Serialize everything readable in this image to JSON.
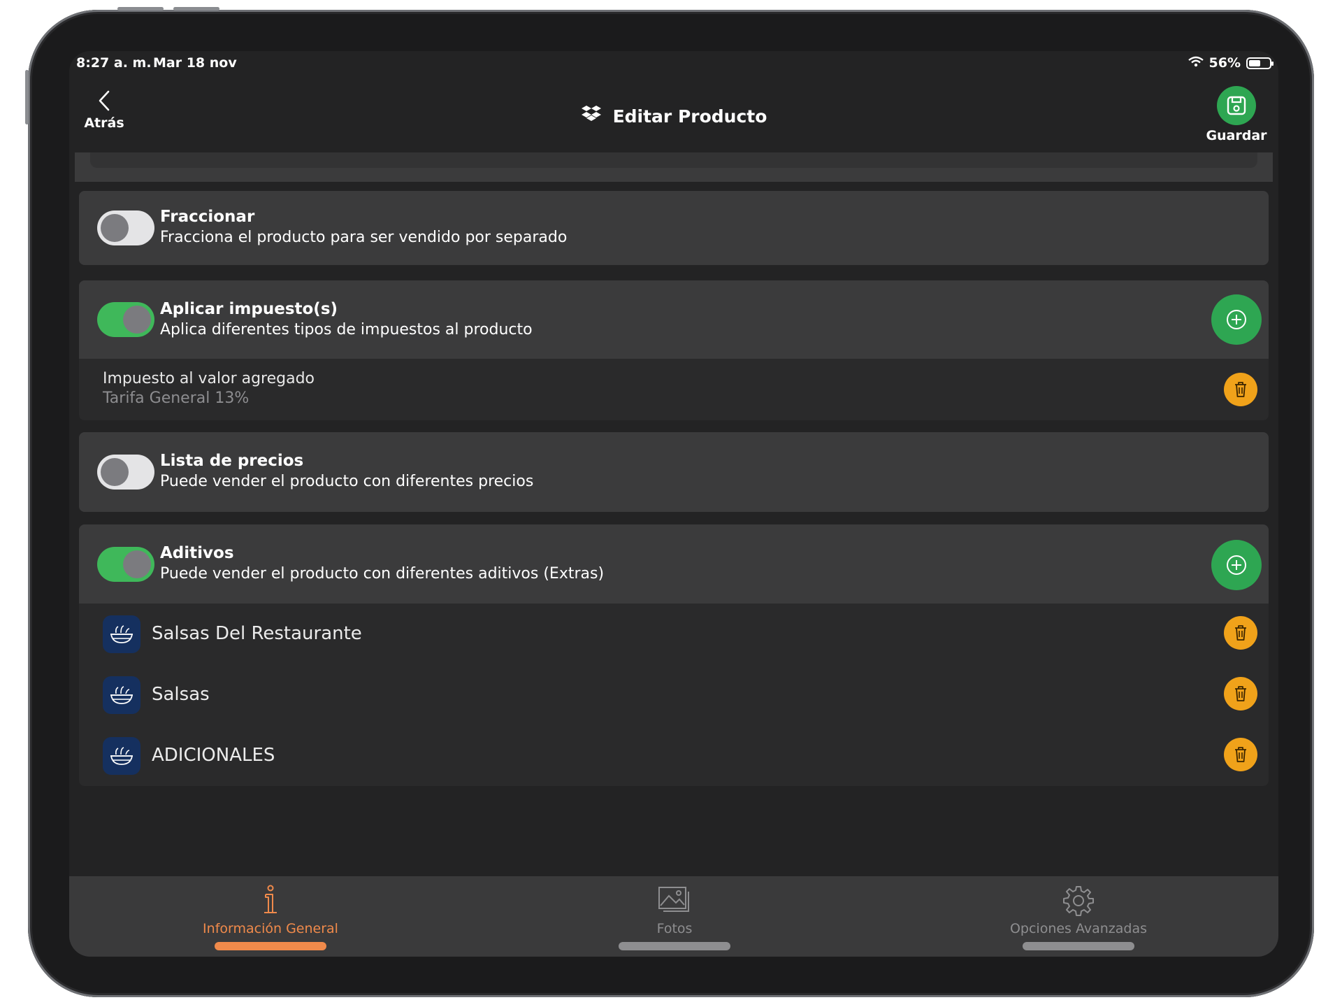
{
  "status_bar": {
    "time": "8:27 a. m.",
    "date": "Mar 18 nov",
    "battery": "56%",
    "battery_level": 0.56
  },
  "nav": {
    "back_label": "Atrás",
    "title": "Editar Producto",
    "save_label": "Guardar"
  },
  "sections": {
    "fraccionar": {
      "title": "Fraccionar",
      "subtitle": "Fracciona el producto para ser vendido por separado",
      "enabled": false
    },
    "impuestos": {
      "title": "Aplicar impuesto(s)",
      "subtitle": "Aplica diferentes tipos de impuestos al producto",
      "enabled": true,
      "items": [
        {
          "name": "Impuesto al valor agregado",
          "rate": "Tarifa General 13%"
        }
      ]
    },
    "precios": {
      "title": "Lista de precios",
      "subtitle": "Puede vender el producto con diferentes precios",
      "enabled": false
    },
    "aditivos": {
      "title": "Aditivos",
      "subtitle": "Puede vender el producto con diferentes aditivos (Extras)",
      "enabled": true,
      "items": [
        {
          "label": "Salsas Del Restaurante"
        },
        {
          "label": "Salsas"
        },
        {
          "label": "ADICIONALES"
        }
      ]
    }
  },
  "tabs": [
    {
      "label": "Información General",
      "icon": "info-icon",
      "active": true
    },
    {
      "label": "Fotos",
      "icon": "photos-icon",
      "active": false
    },
    {
      "label": "Opciones Avanzadas",
      "icon": "gear-icon",
      "active": false
    }
  ],
  "colors": {
    "accent_green": "#2ea652",
    "toggle_on": "#3fb85a",
    "delete_orange": "#f0a21a",
    "active_tab": "#f08a4b",
    "inactive_tab": "#8e8e90",
    "item_icon_bg": "#15305f"
  }
}
